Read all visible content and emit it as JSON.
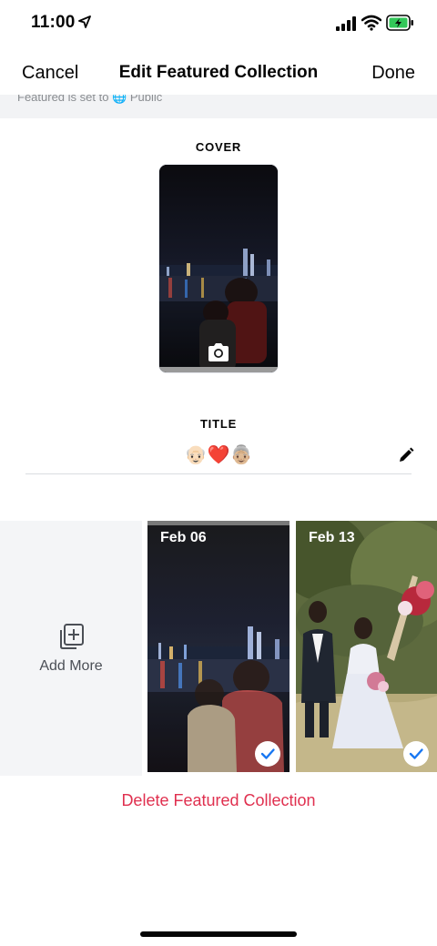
{
  "status_bar": {
    "time": "11:00",
    "icons": [
      "location-arrow-icon",
      "cellular-signal-icon",
      "wifi-icon",
      "battery-charging-icon"
    ],
    "battery_color": "#32c759"
  },
  "nav": {
    "cancel_label": "Cancel",
    "title": "Edit Featured Collection",
    "done_label": "Done"
  },
  "privacy": {
    "text": "Featured is set to 🌐 Public"
  },
  "cover": {
    "label": "COVER",
    "camera_icon": "camera-icon"
  },
  "title_field": {
    "label": "TITLE",
    "value": "👴🏻❤️👵🏼",
    "edit_icon": "pencil-icon"
  },
  "stories": {
    "add_more_label": "Add More",
    "add_more_icon": "add-photos-icon",
    "items": [
      {
        "date": "Feb 06",
        "selected": true
      },
      {
        "date": "Feb 13",
        "selected": true
      }
    ]
  },
  "actions": {
    "delete_label": "Delete Featured Collection",
    "delete_color": "#e0304f"
  }
}
